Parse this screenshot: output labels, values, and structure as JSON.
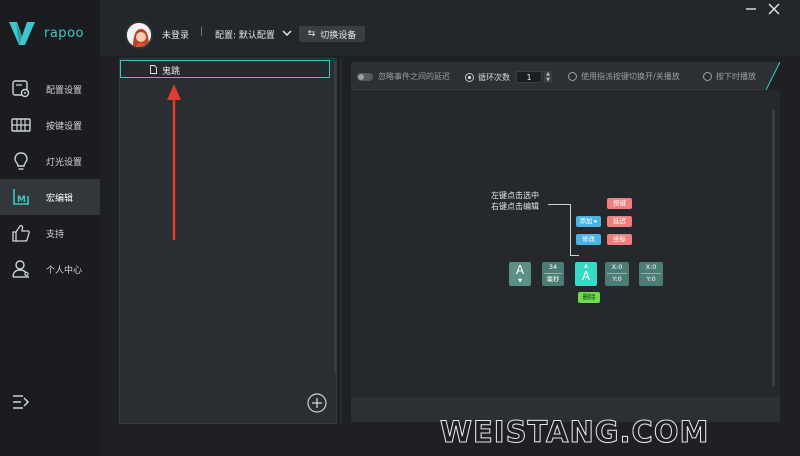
{
  "brand": {
    "name": "rapoo",
    "color": "#3fc7c9"
  },
  "sidebar": {
    "items": [
      {
        "label": "配置设置",
        "icon": "settings-icon",
        "active": false
      },
      {
        "label": "按键设置",
        "icon": "keyboard-icon",
        "active": false
      },
      {
        "label": "灯光设置",
        "icon": "lightbulb-icon",
        "active": false
      },
      {
        "label": "宏编辑",
        "icon": "macro-icon",
        "active": true
      },
      {
        "label": "支持",
        "icon": "thumbs-up-icon",
        "active": false
      },
      {
        "label": "个人中心",
        "icon": "user-icon",
        "active": false
      }
    ],
    "collapse_icon": "collapse-menu-icon"
  },
  "header": {
    "login_status": "未登录",
    "separator": "|",
    "config_label": "配置: 默认配置",
    "switch_device": "切换设备"
  },
  "macro_list": {
    "items": [
      {
        "name": "鬼跳"
      }
    ]
  },
  "options": {
    "ignore_delay": "忽略事件之间的延迟",
    "loop_label": "循环次数",
    "loop_count": "1",
    "toggle_option": "使用指派按键切换开/关播放",
    "hold_option": "按下时播放"
  },
  "editor": {
    "hint_line1": "左键点击选中",
    "hint_line2": "右键点击编辑",
    "tiles": {
      "key1": "A",
      "delay_value": "34",
      "delay_unit": "毫秒",
      "key2": "A",
      "coord1_x": "X:0",
      "coord1_y": "Y:0",
      "coord2_x": "X:0",
      "coord2_y": "Y:0"
    },
    "menu": {
      "add": "添加 ▸",
      "edit": "修改",
      "key": "按键",
      "delay": "延迟",
      "coord": "坐标",
      "delete": "删除"
    }
  },
  "watermark": "WEISTANG.COM",
  "colors": {
    "accent": "#3bc7c4",
    "selected_tile": "#38d9c6",
    "add_blue": "#4ab3e6",
    "menu_red": "#f07e7e",
    "delete_green": "#6fdc4e"
  }
}
